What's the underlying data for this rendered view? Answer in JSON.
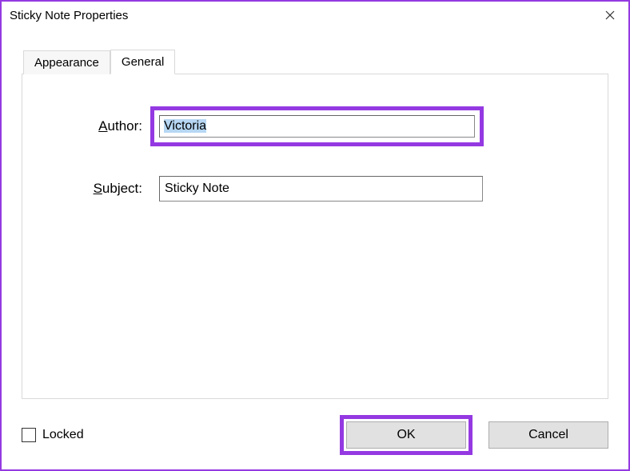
{
  "window": {
    "title": "Sticky Note Properties"
  },
  "tabs": {
    "appearance": "Appearance",
    "general": "General"
  },
  "form": {
    "author_label_underline": "A",
    "author_label_rest": "uthor:",
    "author_value": "Victoria",
    "subject_label_underline": "S",
    "subject_label_rest": "ubject:",
    "subject_value": "Sticky Note"
  },
  "footer": {
    "locked_label": "Locked",
    "ok_label": "OK",
    "cancel_label": "Cancel"
  }
}
